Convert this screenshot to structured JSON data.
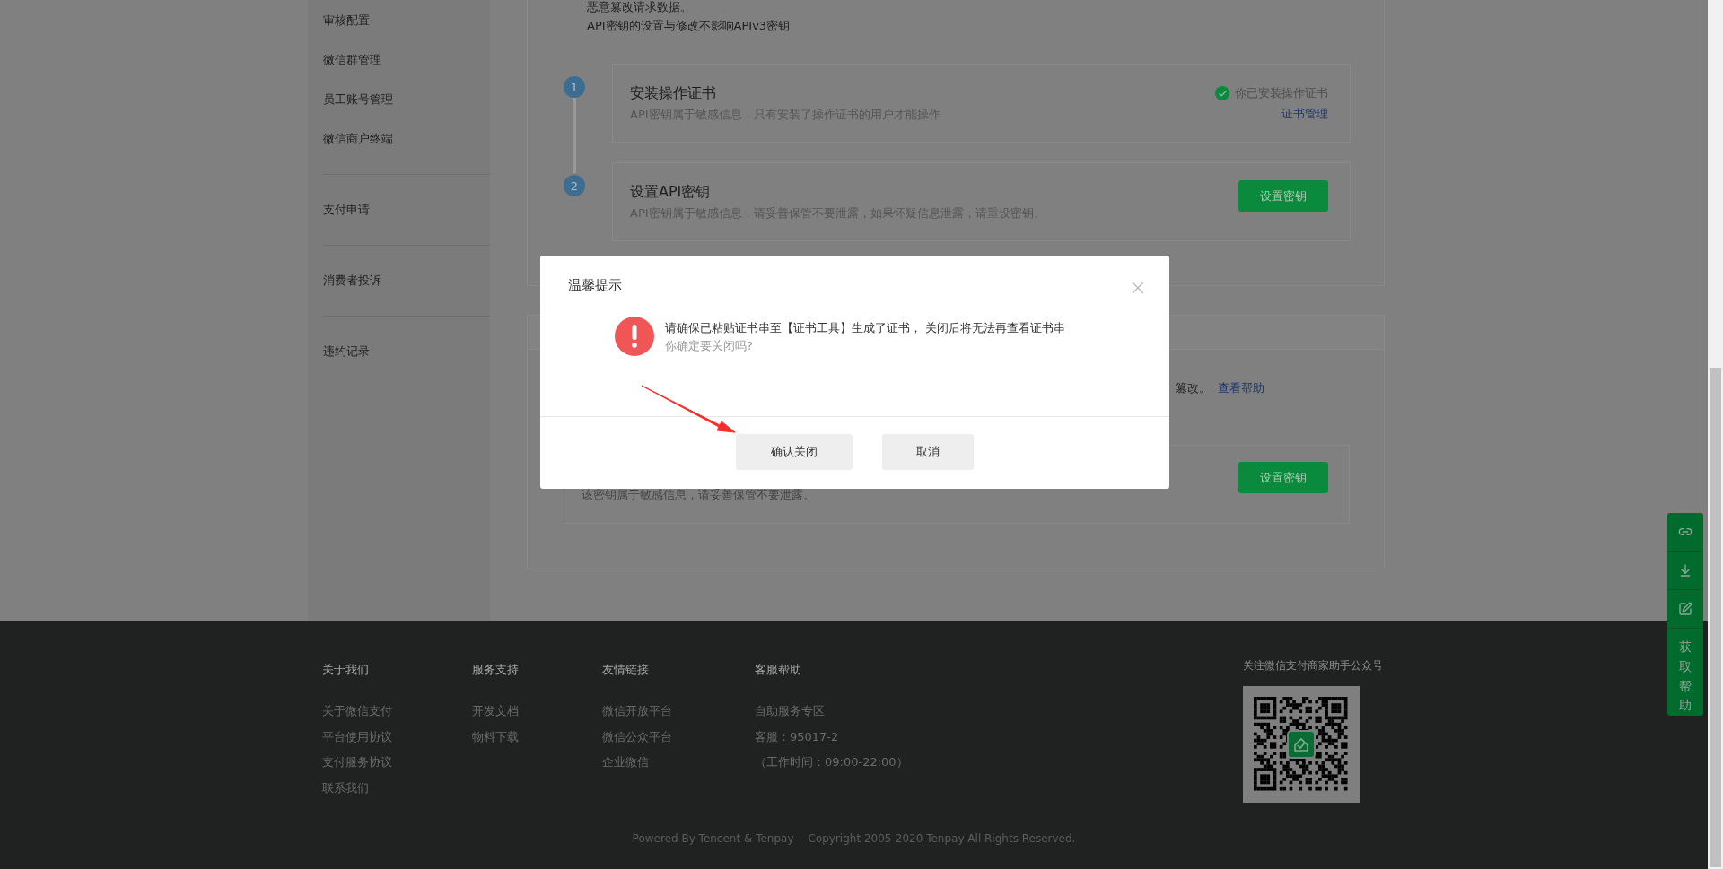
{
  "sidebar": {
    "groups": [
      {
        "items": [
          "审核配置",
          "微信群管理",
          "员工账号管理",
          "微信商户终端"
        ]
      },
      {
        "items": [
          "支付申请"
        ]
      },
      {
        "items": [
          "消费者投诉"
        ]
      },
      {
        "items": [
          "违约记录"
        ]
      }
    ]
  },
  "content": {
    "intro_lines": [
      "恶意篡改请求数据。",
      "API密钥的设置与修改不影响APIv3密钥"
    ],
    "steps": [
      {
        "kind": "status",
        "number": "1",
        "title": "安装操作证书",
        "description": "API密钥属于敏感信息，只有安装了操作证书的用户才能操作",
        "status": "你已安装操作证书",
        "link": "证书管理"
      },
      {
        "kind": "button",
        "number": "2",
        "title": "设置API密钥",
        "description": "API密钥属于敏感信息，请妥善保管不要泄露，如果怀疑信息泄露，请重设密钥。",
        "button": "设置密钥"
      }
    ]
  },
  "second_card": {
    "notice_tail": "篡改。",
    "help_link": "查看帮助",
    "key_description": "该密钥属于敏感信息，请妥善保管不要泄露。",
    "button": "设置密钥"
  },
  "dialog": {
    "title": "温馨提示",
    "message": "请确保已粘贴证书串至【证书工具】生成了证书， 关闭后将无法再查看证书串",
    "question": "你确定要关闭吗?",
    "buttons": [
      "确认关闭",
      "取消"
    ]
  },
  "help_float": {
    "label": "获取帮助"
  },
  "footer": {
    "columns": [
      {
        "heading": "关于我们",
        "links": [
          "关于微信支付",
          "平台使用协议",
          "支付服务协议",
          "联系我们"
        ]
      },
      {
        "heading": "服务支持",
        "links": [
          "开发文档",
          "物料下载"
        ]
      },
      {
        "heading": "友情链接",
        "links": [
          "微信开放平台",
          "微信公众平台",
          "企业微信"
        ]
      },
      {
        "heading": "客服帮助",
        "links": [
          "自助服务专区",
          "客服：95017-2",
          "（工作时间：09:00-22:00）"
        ]
      }
    ],
    "qr_caption": "关注微信支付商家助手公众号",
    "powered": "Powered By Tencent & Tenpay",
    "copyright": "Copyright 2005-2020 Tenpay All Rights Reserved."
  }
}
